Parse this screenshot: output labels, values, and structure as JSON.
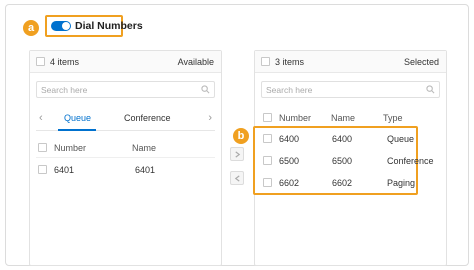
{
  "badges": {
    "a": "a",
    "b": "b"
  },
  "dial_numbers": {
    "label": "Dial Numbers",
    "enabled": true
  },
  "available": {
    "count_label": "4 items",
    "title": "Available",
    "search_placeholder": "Search here",
    "tabs": [
      {
        "label": "Queue",
        "active": true
      },
      {
        "label": "Conference",
        "active": false
      }
    ],
    "columns": {
      "number": "Number",
      "name": "Name"
    },
    "rows": [
      {
        "number": "6401",
        "name": "6401"
      }
    ]
  },
  "selected": {
    "count_label": "3 items",
    "title": "Selected",
    "search_placeholder": "Search here",
    "columns": {
      "number": "Number",
      "name": "Name",
      "type": "Type"
    },
    "rows": [
      {
        "number": "6400",
        "name": "6400",
        "type": "Queue"
      },
      {
        "number": "6500",
        "name": "6500",
        "type": "Conference"
      },
      {
        "number": "6602",
        "name": "6602",
        "type": "Paging"
      }
    ]
  },
  "colors": {
    "accent": "#0071ce",
    "highlight": "#f0a020"
  },
  "icons": {
    "search": "search-icon",
    "prev": "chevron-left-icon",
    "next": "chevron-right-icon",
    "move_right": "arrow-right-icon",
    "move_left": "arrow-left-icon"
  }
}
